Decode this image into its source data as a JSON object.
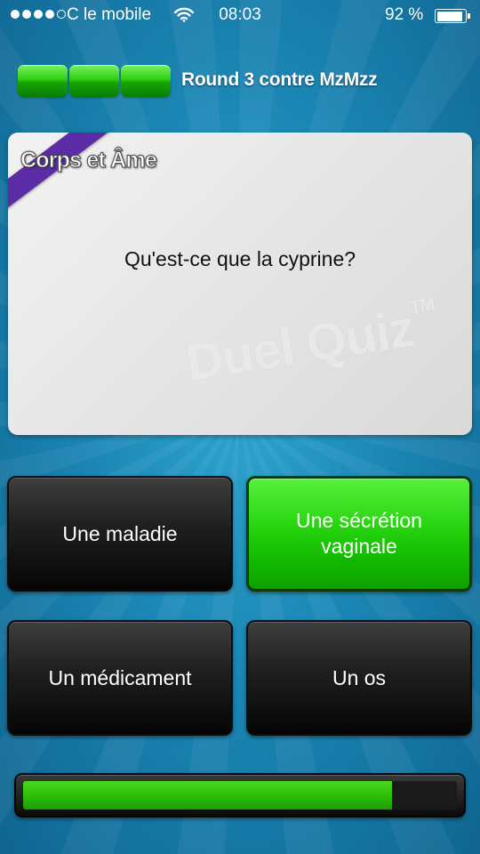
{
  "status_bar": {
    "carrier": "C le mobile",
    "time": "08:03",
    "battery_percent": "92 %",
    "battery_level": 0.92,
    "signal_bars_filled": 4,
    "signal_bars_total": 5
  },
  "header": {
    "rounds_completed": 3,
    "round_title": "Round 3 contre MzMzz"
  },
  "question_card": {
    "category": "Corps et Âme",
    "category_color": "#5b2ca6",
    "question": "Qu'est-ce que la cyprine?",
    "watermark": "Duel Quiz",
    "watermark_tm": "TM"
  },
  "answers": [
    {
      "label": "Une maladie",
      "state": "neutral"
    },
    {
      "label": "Une sécrétion vaginale",
      "state": "correct"
    },
    {
      "label": "Un médicament",
      "state": "neutral"
    },
    {
      "label": "Un os",
      "state": "neutral"
    }
  ],
  "timer": {
    "remaining_fraction": 0.85,
    "fill_color": "#2fbf0a"
  }
}
